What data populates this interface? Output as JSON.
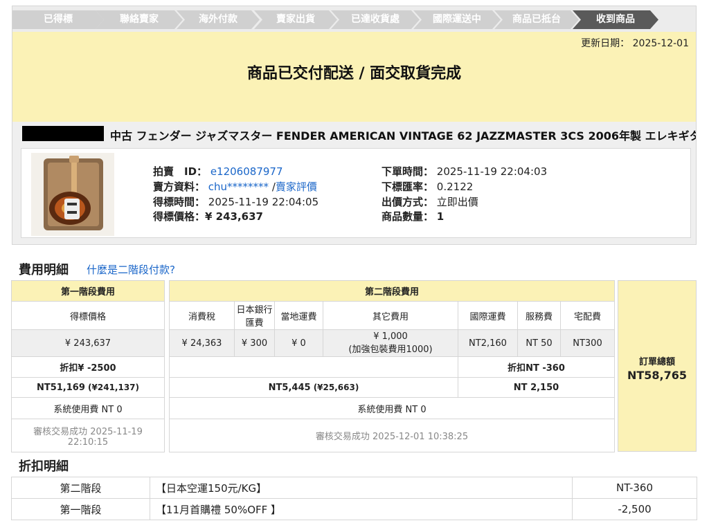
{
  "steps": [
    "已得標",
    "聯絡賣家",
    "海外付款",
    "賣家出貨",
    "已達收貨處",
    "國際運送中",
    "商品已抵台",
    "收到商品"
  ],
  "active_step": 7,
  "banner": {
    "update_label": "更新日期：",
    "update_date": "2025-12-01",
    "status_title": "商品已交付配送 / 面交取貨完成"
  },
  "product": {
    "title": "中古 フェンダー ジャズマスター FENDER AMERICAN VINTAGE 62 JAZZMASTER 3CS 2006年製 エレキギタ",
    "auction_id_label": "拍賣　ID：",
    "auction_id": "e1206087977",
    "seller_label": "賣方資料：",
    "seller": "chu********",
    "seller_sep": " /",
    "seller_rating": "賣家評價",
    "won_time_label": "得標時間：",
    "won_time": "2025-11-19 22:04:05",
    "won_price_label": "得標價格：",
    "won_price": "¥ 243,637",
    "order_time_label": "下單時間：",
    "order_time": "2025-11-19 22:04:03",
    "rate_label": "下標匯率：",
    "rate": "0.2122",
    "bid_method_label": "出價方式：",
    "bid_method": "立即出價",
    "qty_label": "商品數量：",
    "qty": "1"
  },
  "fees": {
    "title": "費用明細",
    "help_link": "什麼是二階段付款?",
    "stage1_header": "第一階段費用",
    "stage2_header": "第二階段費用",
    "cols": {
      "won_price": "得標價格",
      "tax": "消費稅",
      "bank_fee": "日本銀行匯費",
      "local_ship": "當地運費",
      "other": "其它費用",
      "intl_ship": "國際運費",
      "service": "服務費",
      "delivery": "宅配費"
    },
    "vals": {
      "won_price": "¥ 243,637",
      "tax": "¥ 24,363",
      "bank_fee": "¥ 300",
      "local_ship": "¥ 0",
      "other": "¥ 1,000",
      "other_note": "(加強包裝費用1000)",
      "intl_ship": "NT2,160",
      "service": "NT 50",
      "delivery": "NT300"
    },
    "stage1_discount": "折扣¥ -2500",
    "stage2_discount": "折扣NT -360",
    "stage1_total": "NT51,169",
    "stage1_total_yen": "(¥241,137)",
    "stage2_total": "NT5,445",
    "stage2_total_yen": "(¥25,663)",
    "stage2_total_b": "NT 2,150",
    "sys_fee_1": "系統使用費 NT 0",
    "sys_fee_2": "系統使用費 NT 0",
    "audit_1": "審核交易成功 2025-11-19 22:10:15",
    "audit_2": "審核交易成功 2025-12-01 10:38:25",
    "order_total_label": "訂單總額",
    "order_total": "NT58,765"
  },
  "discounts": {
    "title": "折扣明細",
    "rows": [
      {
        "stage": "第二階段",
        "desc": "【日本空運150元/KG】",
        "amount": "NT-360"
      },
      {
        "stage": "第一階段",
        "desc": "【11月首購禮 50%OFF 】",
        "amount": "-2,500"
      }
    ]
  }
}
